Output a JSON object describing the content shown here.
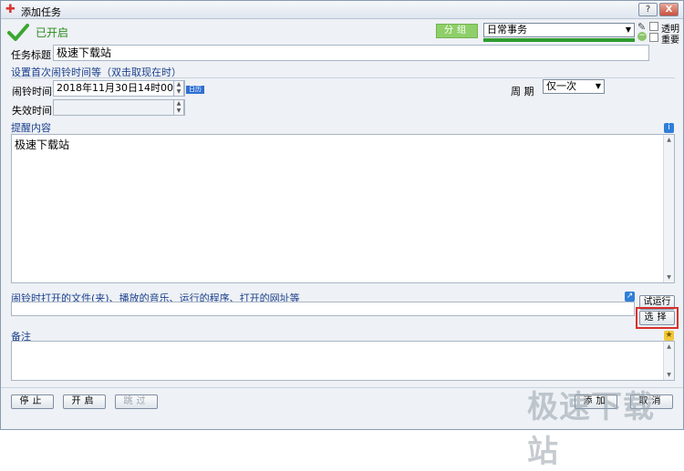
{
  "window": {
    "title": "添加任务",
    "help_label": "?",
    "close_label": "X"
  },
  "status": {
    "label": "已开启"
  },
  "group": {
    "button_label": "分组",
    "category_value": "日常事务"
  },
  "options": {
    "transparent_label": "透明",
    "important_label": "重要"
  },
  "task_title": {
    "label": "任务标题",
    "value": "极速下载站"
  },
  "schedule": {
    "section_label": "设置首次闹铃时间等（双击取现在时）",
    "alarm_time_label": "闹铃时间",
    "alarm_time_value": "2018年11月30日14时00分",
    "calendar_label": "日历",
    "expire_time_label": "失效时间",
    "expire_time_value": "",
    "cycle_label": "周  期",
    "cycle_value": "仅一次"
  },
  "reminder": {
    "section_label": "提醒内容",
    "content": "极速下载站"
  },
  "open_target": {
    "section_label": "闹铃时打开的文件(夹)、播放的音乐、运行的程序、打开的网址等",
    "value": "",
    "test_run_label": "试运行",
    "select_label": "选择"
  },
  "notes": {
    "section_label": "备注",
    "content": ""
  },
  "footer": {
    "stop_label": "停止",
    "start_label": "开启",
    "skip_label": "跳过",
    "add_label": "添加",
    "cancel_label": "取消"
  },
  "watermark": "极速下载站",
  "colors": {
    "accent_green": "#2e9b2e",
    "highlight_red": "#d9302c",
    "section_blue": "#1a3f8c"
  }
}
